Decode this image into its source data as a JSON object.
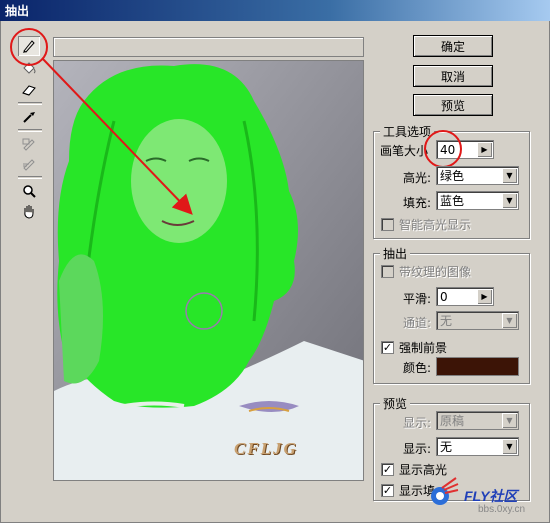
{
  "window": {
    "title": "抽出"
  },
  "tools": [
    {
      "name": "edge-highlighter-icon"
    },
    {
      "name": "fill-icon"
    },
    {
      "name": "eraser-icon"
    },
    {
      "name": "eyedropper-icon"
    },
    {
      "name": "cleanup-icon"
    },
    {
      "name": "edge-touchup-icon"
    },
    {
      "name": "zoom-icon"
    },
    {
      "name": "hand-icon"
    }
  ],
  "buttons": {
    "ok": "确定",
    "cancel": "取消",
    "preview": "预览"
  },
  "tool_options": {
    "legend": "工具选项",
    "brush_size_label": "画笔大小",
    "brush_size_value": "40",
    "highlight_label": "高光:",
    "highlight_value": "绿色",
    "fill_label": "填充:",
    "fill_value": "蓝色",
    "smart_highlight_label": "智能高光显示",
    "smart_highlight_checked": false
  },
  "extraction": {
    "legend": "抽出",
    "textured_label": "带纹理的图像",
    "textured_checked": false,
    "smooth_label": "平滑:",
    "smooth_value": "0",
    "channel_label": "通道:",
    "channel_value": "无",
    "force_fg_label": "强制前景",
    "force_fg_checked": true,
    "color_label": "颜色:",
    "color_value": "#3c1406"
  },
  "preview_group": {
    "legend": "预览",
    "show_label": "显示:",
    "show_value": "原稿",
    "display_label": "显示:",
    "display_value": "无",
    "show_highlight_label": "显示高光",
    "show_highlight_checked": true,
    "show_fill_label": "显示填",
    "show_fill_checked": true
  },
  "watermarks": {
    "logo_text": "CFLJG",
    "site_name": "FLY社区",
    "site_url": "bbs.0xy.cn"
  },
  "colors": {
    "highlight_green": "#28e628",
    "annotation_red": "#e01818",
    "title_bar": "#0a246a"
  }
}
